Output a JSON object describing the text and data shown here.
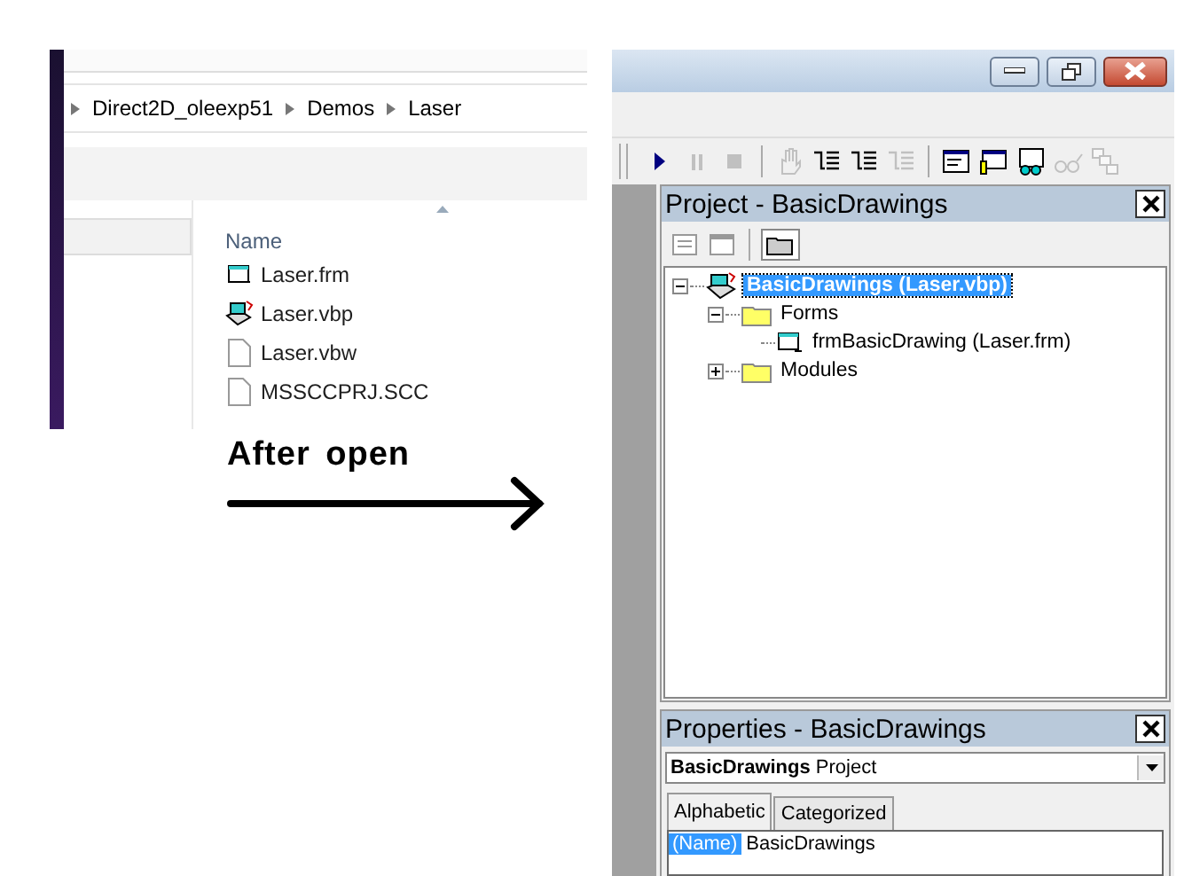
{
  "explorer": {
    "breadcrumb": [
      "Direct2D_oleexp51",
      "Demos",
      "Laser"
    ],
    "column_header": "Name",
    "files": [
      {
        "name": "Laser.frm",
        "kind": "form"
      },
      {
        "name": "Laser.vbp",
        "kind": "project"
      },
      {
        "name": "Laser.vbw",
        "kind": "file"
      },
      {
        "name": "MSSCCPRJ.SCC",
        "kind": "file"
      }
    ]
  },
  "annotation": {
    "caption": "After open"
  },
  "ide": {
    "toolbar": [
      {
        "kind": "run",
        "disabled": false
      },
      {
        "kind": "pause",
        "disabled": true
      },
      {
        "kind": "stop",
        "disabled": true
      },
      {
        "kind": "sep"
      },
      {
        "kind": "hand",
        "disabled": true
      },
      {
        "kind": "step-in",
        "disabled": false
      },
      {
        "kind": "step-over",
        "disabled": false
      },
      {
        "kind": "step-out",
        "disabled": true
      },
      {
        "kind": "sep"
      },
      {
        "kind": "window",
        "disabled": false
      },
      {
        "kind": "props",
        "disabled": false
      },
      {
        "kind": "browser",
        "disabled": false
      },
      {
        "kind": "glasses",
        "disabled": true
      },
      {
        "kind": "stack",
        "disabled": true
      }
    ],
    "project": {
      "title": "Project - BasicDrawings",
      "toggle_folders": true,
      "tree": [
        {
          "label": "BasicDrawings (Laser.vbp)",
          "kind": "project",
          "selected": true,
          "expanded": true,
          "children": [
            {
              "label": "Forms",
              "kind": "folder",
              "selected": false,
              "expanded": true,
              "children": [
                {
                  "label": "frmBasicDrawing (Laser.frm)",
                  "kind": "form",
                  "selected": false
                }
              ]
            },
            {
              "label": "Modules",
              "kind": "folder",
              "selected": false,
              "expanded": false
            }
          ]
        }
      ]
    },
    "properties": {
      "title": "Properties - BasicDrawings",
      "object": "**BasicDrawings** Project",
      "tabs": [
        {
          "label": "Alphabetic",
          "selected": true
        },
        {
          "label": "Categorized",
          "selected": false
        }
      ],
      "rows": [
        {
          "name": "(Name)",
          "value": "BasicDrawings",
          "selected": true
        }
      ]
    }
  }
}
